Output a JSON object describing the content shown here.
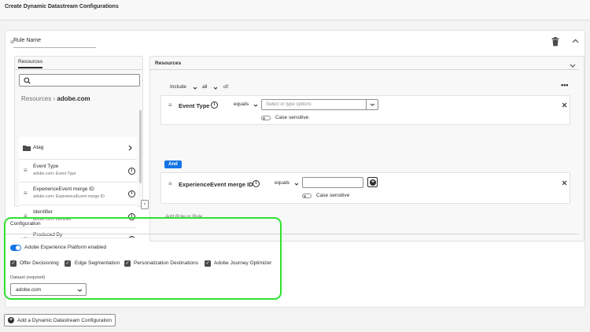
{
  "page": {
    "title": "Create Dynamic Datastream Configurations"
  },
  "rule": {
    "name": "Rule Name"
  },
  "resources_panel": {
    "tab_label": "Resources",
    "breadcrumb_root": "Resources",
    "breadcrumb_separator": "›",
    "breadcrumb_current": "adobe.com",
    "items": [
      {
        "title": "Atag",
        "subtitle": "",
        "icon": "folder-icon"
      },
      {
        "title": "Event Type",
        "subtitle": "adobe.com› Event Type"
      },
      {
        "title": "ExperienceEvent merge ID",
        "subtitle": "adobe.com› ExperienceEvent merge ID"
      },
      {
        "title": "Identifier",
        "subtitle": "adobe.com› Identifier"
      },
      {
        "title": "Produced By",
        "subtitle": ""
      }
    ]
  },
  "conditions_panel": {
    "title": "Resources",
    "include_label": "Include",
    "match_label": "all",
    "of_label": "of:",
    "conditions": [
      {
        "field": "Event Type",
        "operator": "equals",
        "placeholder": "Select or type options",
        "case_label": "Case sensitive"
      },
      {
        "field": "ExperienceEvent merge ID",
        "operator": "equals",
        "placeholder": "",
        "case_label": "Case sensitive"
      }
    ],
    "and_label": "And",
    "add_rule_label": "Add Role or Rule"
  },
  "configuration": {
    "title": "Configuration",
    "aep_label": "Adobe Experience Platform enabled",
    "aep_enabled": true,
    "checkboxes": [
      {
        "label": "Offer Decisioning",
        "checked": true
      },
      {
        "label": "Edge Segmentation",
        "checked": true
      },
      {
        "label": "Personalization Destinations",
        "checked": true
      },
      {
        "label": "Adobe Journey Optimizer",
        "checked": true
      }
    ],
    "dataset_label": "Dataset (required)",
    "dataset_value": "adobe.com"
  },
  "footer": {
    "add_button_label": "Add a Dynamic Datastream Configuration"
  },
  "colors": {
    "accent": "#1473e6",
    "highlight": "#2ee32e"
  }
}
